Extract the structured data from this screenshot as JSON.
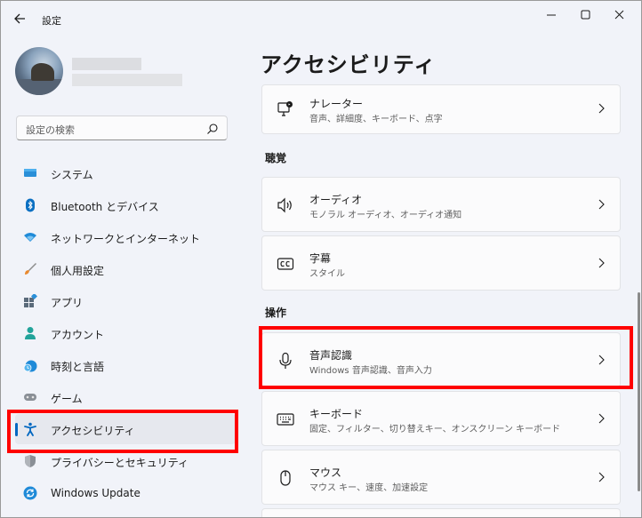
{
  "window": {
    "title": "設定"
  },
  "sidebar": {
    "search_placeholder": "設定の検索",
    "items": [
      {
        "label": "システム",
        "icon": "monitor-icon",
        "color": "#0078d4"
      },
      {
        "label": "Bluetooth とデバイス",
        "icon": "bluetooth-icon",
        "color": "#0078d4"
      },
      {
        "label": "ネットワークとインターネット",
        "icon": "wifi-icon",
        "color": "#1a8ad4"
      },
      {
        "label": "個人用設定",
        "icon": "brush-icon",
        "color": "#e68a2e"
      },
      {
        "label": "アプリ",
        "icon": "apps-icon",
        "color": "#4a5a6a"
      },
      {
        "label": "アカウント",
        "icon": "account-icon",
        "color": "#22a39a"
      },
      {
        "label": "時刻と言語",
        "icon": "clock-globe-icon",
        "color": "#1a8ad4"
      },
      {
        "label": "ゲーム",
        "icon": "gamepad-icon",
        "color": "#6b6b6b"
      },
      {
        "label": "アクセシビリティ",
        "icon": "accessibility-icon",
        "color": "#0067c0",
        "selected": true
      },
      {
        "label": "プライバシーとセキュリティ",
        "icon": "shield-icon",
        "color": "#6b6b6b"
      },
      {
        "label": "Windows Update",
        "icon": "update-icon",
        "color": "#1a8ad4"
      }
    ]
  },
  "main": {
    "title": "アクセシビリティ",
    "sections": {
      "hearing": "聴覚",
      "interaction": "操作"
    },
    "cards": {
      "narrator": {
        "title": "ナレーター",
        "subtitle": "音声、詳細度、キーボード、点字",
        "icon": "narrator-icon"
      },
      "audio": {
        "title": "オーディオ",
        "subtitle": "モノラル オーディオ、オーディオ通知",
        "icon": "speaker-icon"
      },
      "captions": {
        "title": "字幕",
        "subtitle": "スタイル",
        "icon": "cc-icon"
      },
      "speech": {
        "title": "音声認識",
        "subtitle": "Windows 音声認識、音声入力",
        "icon": "microphone-icon"
      },
      "keyboard": {
        "title": "キーボード",
        "subtitle": "固定、フィルター、切り替えキー、オンスクリーン キーボード",
        "icon": "keyboard-icon"
      },
      "mouse": {
        "title": "マウス",
        "subtitle": "マウス キー、速度、加速設定",
        "icon": "mouse-icon"
      }
    }
  },
  "colors": {
    "accent": "#0067c0",
    "highlight": "#ff0000",
    "background": "#f1f3f9"
  }
}
